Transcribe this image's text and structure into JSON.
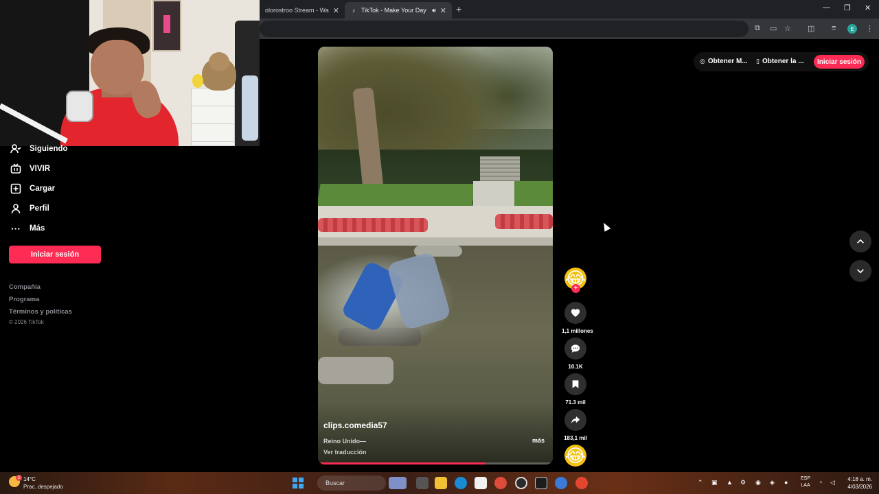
{
  "browser": {
    "tabs": [
      {
        "title": "olorostroo Stream - Watch",
        "active": false
      },
      {
        "title": "TikTok - Make Your Day",
        "active": true
      }
    ],
    "new_tab_icon": "plus-icon",
    "window_controls": [
      "minimize-icon",
      "restore-icon",
      "close-icon"
    ],
    "profile_initial": "E",
    "toolbar_icons": [
      "translate-icon",
      "install-icon",
      "bookmark-star-icon",
      "extensions-icon",
      "reading-list-icon",
      "menu-icon"
    ]
  },
  "sidebar": {
    "items": [
      {
        "label": "Siguiendo",
        "icon": "following-icon"
      },
      {
        "label": "VIVIR",
        "icon": "live-icon"
      },
      {
        "label": "Cargar",
        "icon": "upload-icon"
      },
      {
        "label": "Perfil",
        "icon": "profile-icon"
      },
      {
        "label": "Más",
        "icon": "more-icon"
      }
    ],
    "login_label": "Iniciar sesión",
    "footer_links": [
      "Compañía",
      "Programa",
      "Términos y políticas"
    ],
    "copyright": "© 2026 TikTok"
  },
  "header": {
    "links": [
      {
        "label": "Obtener M...",
        "icon": "coin-icon"
      },
      {
        "label": "Obtener la ...",
        "icon": "phone-icon"
      }
    ],
    "login_label": "Iniciar sesión"
  },
  "video": {
    "author": "clips.comedia57",
    "caption": "Reino Unido—",
    "more_label": "más",
    "translate_label": "Ver traducción",
    "progress": 0.71
  },
  "actions": {
    "avatar_emoji": "😂",
    "follow_icon": "plus-icon",
    "like": {
      "icon": "heart-icon",
      "count": "1,1 millones"
    },
    "comment": {
      "icon": "comment-icon",
      "count": "10.1K"
    },
    "save": {
      "icon": "bookmark-icon",
      "count": "71.3 mil"
    },
    "share": {
      "icon": "share-icon",
      "count": "183,1 mil"
    },
    "music_emoji": "😂"
  },
  "taskbar": {
    "weather_temp": "14°C",
    "weather_cond": "Prac. despejado",
    "weather_badge": "2",
    "search_placeholder": "Buscar",
    "language_line1": "ESP",
    "language_line2": "LAA",
    "time": "4:18 a. m.",
    "date": "4/03/2026"
  },
  "colors": {
    "accent": "#fe2c55",
    "background": "#000000",
    "chrome_bg": "#35363a"
  }
}
